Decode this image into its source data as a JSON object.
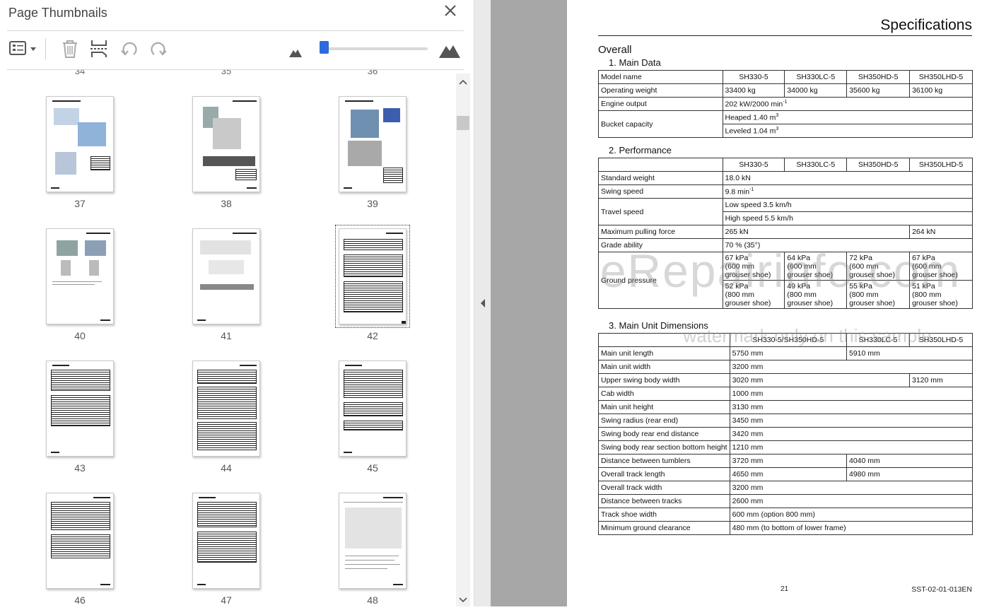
{
  "thumbnails_pane": {
    "title": "Page Thumbnails",
    "toolbar": {
      "options_icon": "thumbnail-options-icon",
      "delete_icon": "trash-icon",
      "insert_icon": "insert-page-icon",
      "rotate_ccw_icon": "rotate-counterclockwise-icon",
      "rotate_cw_icon": "rotate-clockwise-icon",
      "zoom_out_icon": "small-mountain-icon",
      "zoom_in_icon": "large-mountain-icon",
      "zoom_level": 0.02
    },
    "partial_top_numbers": [
      "34",
      "35",
      "36"
    ],
    "pages": [
      {
        "number": "37",
        "selected": false
      },
      {
        "number": "38",
        "selected": false
      },
      {
        "number": "39",
        "selected": false
      },
      {
        "number": "40",
        "selected": false
      },
      {
        "number": "41",
        "selected": false
      },
      {
        "number": "42",
        "selected": true
      },
      {
        "number": "43",
        "selected": false
      },
      {
        "number": "44",
        "selected": false
      },
      {
        "number": "45",
        "selected": false
      },
      {
        "number": "46",
        "selected": false
      },
      {
        "number": "47",
        "selected": false
      },
      {
        "number": "48",
        "selected": false
      }
    ]
  },
  "document": {
    "title": "Specifications",
    "section": "Overall",
    "main_data": {
      "heading": "1. Main Data",
      "header": [
        "Model name",
        "SH330-5",
        "SH330LC-5",
        "SH350HD-5",
        "SH350LHD-5"
      ],
      "operating_weight": {
        "label": "Operating weight",
        "values": [
          "33400 kg",
          "34000 kg",
          "35600 kg",
          "36100 kg"
        ]
      },
      "engine_output": {
        "label": "Engine output",
        "value": "202 kW/2000 min",
        "exp": "-1"
      },
      "bucket_capacity": {
        "label": "Bucket capacity",
        "heaped": "Heaped 1.40 m",
        "leveled": "Leveled 1.04 m",
        "exp": "3"
      }
    },
    "performance": {
      "heading": "2. Performance",
      "header": [
        "SH330-5",
        "SH330LC-5",
        "SH350HD-5",
        "SH350LHD-5"
      ],
      "standard_weight": {
        "label": "Standard weight",
        "value": "18.0 kN"
      },
      "swing_speed": {
        "label": "Swing speed",
        "value": "9.8 min",
        "exp": "-1"
      },
      "travel_speed": {
        "label": "Travel speed",
        "low": "Low speed 3.5 km/h",
        "high": "High speed 5.5 km/h"
      },
      "max_pulling_force": {
        "label": "Maximum pulling force",
        "value": "265 kN",
        "value_lhd": "264 kN"
      },
      "grade_ability": {
        "label": "Grade ability",
        "value": "70 % (35°)"
      },
      "ground_pressure": {
        "label": "Ground pressure",
        "row1": [
          {
            "a": "67 kPa",
            "b": "(600 mm",
            "c": "grouser shoe)"
          },
          {
            "a": "64 kPa",
            "b": "(600 mm",
            "c": "grouser shoe)"
          },
          {
            "a": "72 kPa",
            "b": "(600 mm",
            "c": "grouser shoe)"
          },
          {
            "a": "67 kPa",
            "b": "(600 mm",
            "c": "grouser shoe)"
          }
        ],
        "row2": [
          {
            "a": "52 kPa",
            "b": "(800 mm",
            "c": "grouser shoe)"
          },
          {
            "a": "49 kPa",
            "b": "(800 mm",
            "c": "grouser shoe)"
          },
          {
            "a": "55 kPa",
            "b": "(800 mm",
            "c": "grouser shoe)"
          },
          {
            "a": "51 kPa",
            "b": "(800 mm",
            "c": "grouser shoe)"
          }
        ]
      }
    },
    "dimensions": {
      "heading": "3. Main Unit Dimensions",
      "header": [
        "SH330-5/SH350HD-5",
        "SH330LC-5",
        "SH350LHD-5"
      ],
      "rows": [
        {
          "label": "Main unit length",
          "v1": "5750 mm",
          "v2": "5910 mm"
        },
        {
          "label": "Main unit width",
          "v1": "3200 mm"
        },
        {
          "label": "Upper swing body width",
          "v1": "3020 mm",
          "v3": "3120 mm"
        },
        {
          "label": "Cab width",
          "v1": "1000 mm"
        },
        {
          "label": "Main unit height",
          "v1": "3130 mm"
        },
        {
          "label": "Swing radius (rear end)",
          "v1": "3450 mm"
        },
        {
          "label": "Swing body rear end distance",
          "v1": "3420 mm"
        },
        {
          "label": "Swing body rear section bottom height",
          "v1": "1210 mm"
        },
        {
          "label": "Distance between tumblers",
          "v1": "3720 mm",
          "v2": "4040 mm"
        },
        {
          "label": "Overall track length",
          "v1": "4650 mm",
          "v2": "4980 mm"
        },
        {
          "label": "Overall track width",
          "v1": "3200 mm"
        },
        {
          "label": "Distance between tracks",
          "v1": "2600 mm"
        },
        {
          "label": "Track shoe width",
          "v1": "600 mm (option 800 mm)"
        },
        {
          "label": "Minimum ground clearance",
          "v1": "480 mm (to bottom of lower frame)"
        }
      ]
    },
    "watermark_primary": "eRepairinfo.com",
    "watermark_secondary": "watermark only on this sample",
    "page_number": "21",
    "doc_code": "SST-02-01-013EN"
  }
}
